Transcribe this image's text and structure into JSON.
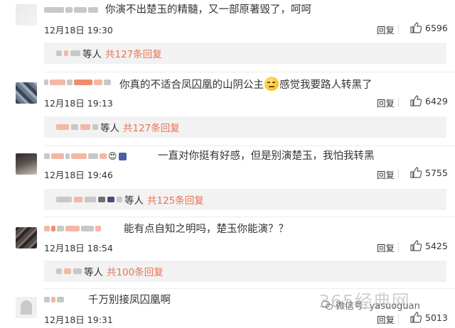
{
  "comments": [
    {
      "text": "你演不出楚玉的精髓，又一部原著毁了，呵呵",
      "time": "12月18日 19:30",
      "reply_label": "回复",
      "likes": "6596",
      "replies": {
        "who": "等人",
        "more": "共127条回复"
      }
    },
    {
      "text_before": "你真的不适合凤囚凰的山阴公主",
      "text_after": "感觉我要路人转黑了",
      "time": "12月18日 19:13",
      "reply_label": "回复",
      "likes": "6429",
      "replies": {
        "who": "等人",
        "more": "共127条回复"
      }
    },
    {
      "text": "一直对你挺有好感，但是别演楚玉，我怕我转黑",
      "time": "12月18日 19:46",
      "reply_label": "回复",
      "likes": "5755",
      "replies": {
        "who": "等人",
        "more": "共125条回复"
      }
    },
    {
      "text": "能有点自知之明吗，楚玉你能演？？",
      "time": "12月18日 18:54",
      "reply_label": "回复",
      "likes": "5425",
      "replies": {
        "who": "等人",
        "more": "共100条回复"
      }
    },
    {
      "text": "千万别接凤囚凰啊",
      "time": "12月18日 19:31",
      "reply_label": "回复",
      "likes": "5013"
    }
  ],
  "watermark": "365经典网",
  "wechat_label": "微信号: yasuoguan",
  "icons": {
    "like": "thumbs-up-icon",
    "wechat": "wechat-icon"
  },
  "colors": {
    "accent": "#eb7350",
    "reply_box": "#f2f2f2"
  }
}
